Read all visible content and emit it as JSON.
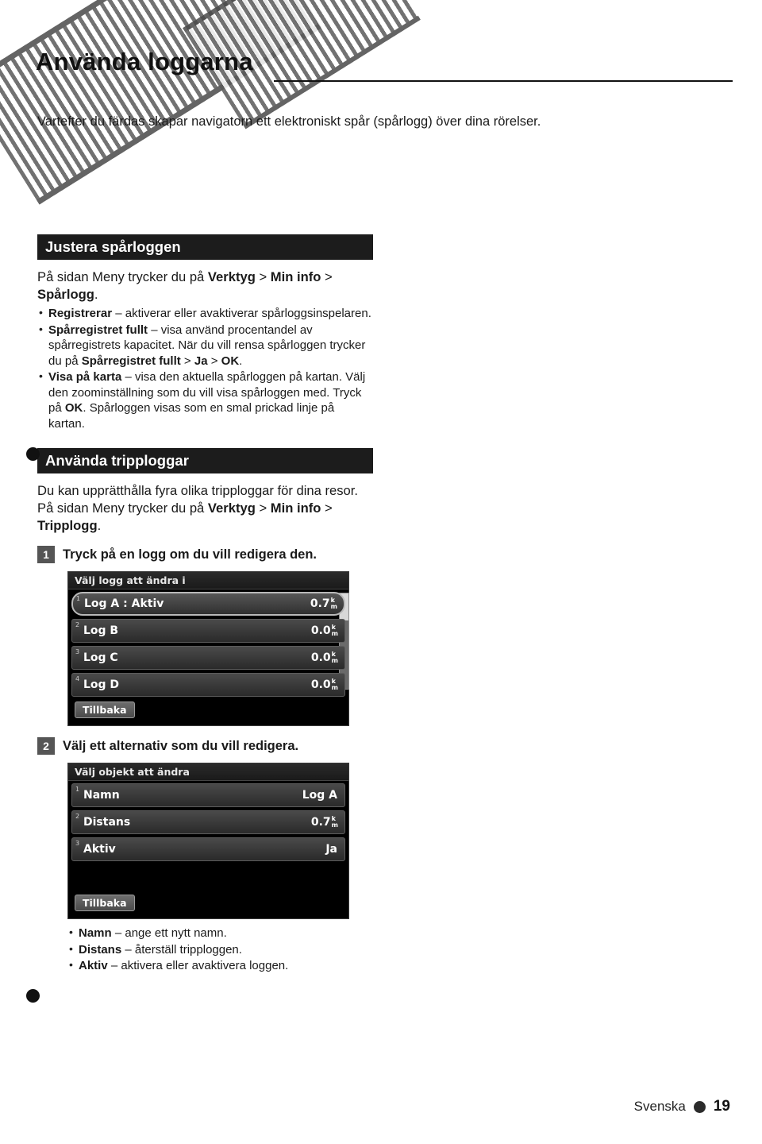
{
  "header": {
    "title": "Använda loggarna",
    "intro": "Vartefter du färdas skapar navigatorn ett elektroniskt spår (spårlogg) över dina rörelser."
  },
  "sections": [
    {
      "heading": "Justera spårloggen",
      "intro_a": "På sidan Meny trycker du på ",
      "intro_b": "Verktyg",
      "intro_c": " > ",
      "intro_d": "Min info",
      "intro_e": " > ",
      "intro_f": "Spårlogg",
      "intro_g": ".",
      "bullets": [
        {
          "bold": "Registrerar",
          "text": " – aktiverar eller avaktiverar spårloggsinspelaren."
        },
        {
          "bold": "Spårregistret fullt",
          "text": " – visa använd procentandel av spårregistrets kapacitet. När du vill rensa spårloggen trycker du på ",
          "bold2": "Spårregistret fullt",
          "text2": " > ",
          "bold3": "Ja",
          "text3": " > ",
          "bold4": "OK",
          "text4": "."
        },
        {
          "bold": "Visa på karta",
          "text": " – visa den aktuella spårloggen på kartan. Välj den zoominställning som du vill visa spårloggen med. Tryck på ",
          "bold2": "OK",
          "text2": ". Spårloggen visas som en smal prickad linje på kartan."
        }
      ]
    },
    {
      "heading": "Använda tripploggar",
      "paragraph_a": "Du kan upprätthålla fyra olika tripploggar för dina resor. På sidan Meny trycker du på ",
      "paragraph_b": "Verktyg",
      "paragraph_c": " > ",
      "paragraph_d": "Min info",
      "paragraph_e": " > ",
      "paragraph_f": "Tripplogg",
      "paragraph_g": "."
    }
  ],
  "steps": [
    {
      "num": "1",
      "text": "Tryck på en logg om du vill redigera den."
    },
    {
      "num": "2",
      "text": "Välj ett alternativ som du vill redigera."
    }
  ],
  "device_logs": {
    "title": "Välj logg att ändra i",
    "rows": [
      {
        "idx": "1",
        "label": "Log A : Aktiv",
        "value": "0.7",
        "unit_top": "k",
        "unit_bot": "m",
        "highlight": true
      },
      {
        "idx": "2",
        "label": "Log B",
        "value": "0.0",
        "unit_top": "k",
        "unit_bot": "m",
        "highlight": false
      },
      {
        "idx": "3",
        "label": "Log C",
        "value": "0.0",
        "unit_top": "k",
        "unit_bot": "m",
        "highlight": false
      },
      {
        "idx": "4",
        "label": "Log D",
        "value": "0.0",
        "unit_top": "k",
        "unit_bot": "m",
        "highlight": false
      }
    ],
    "back_label": "Tillbaka"
  },
  "device_object": {
    "title": "Välj objekt att ändra",
    "rows": [
      {
        "idx": "1",
        "label": "Namn",
        "value": "Log A",
        "unit_top": "",
        "unit_bot": "",
        "highlight": false
      },
      {
        "idx": "2",
        "label": "Distans",
        "value": "0.7",
        "unit_top": "k",
        "unit_bot": "m",
        "highlight": false
      },
      {
        "idx": "3",
        "label": "Aktiv",
        "value": "Ja",
        "unit_top": "",
        "unit_bot": "",
        "highlight": false
      }
    ],
    "back_label": "Tillbaka"
  },
  "final_bullets": [
    {
      "bold": "Namn",
      "text": " – ange ett nytt namn."
    },
    {
      "bold": "Distans",
      "text": " – återställ tripploggen."
    },
    {
      "bold": "Aktiv",
      "text": " – aktivera eller avaktivera loggen."
    }
  ],
  "footer": {
    "language": "Svenska",
    "page_number": "19"
  }
}
